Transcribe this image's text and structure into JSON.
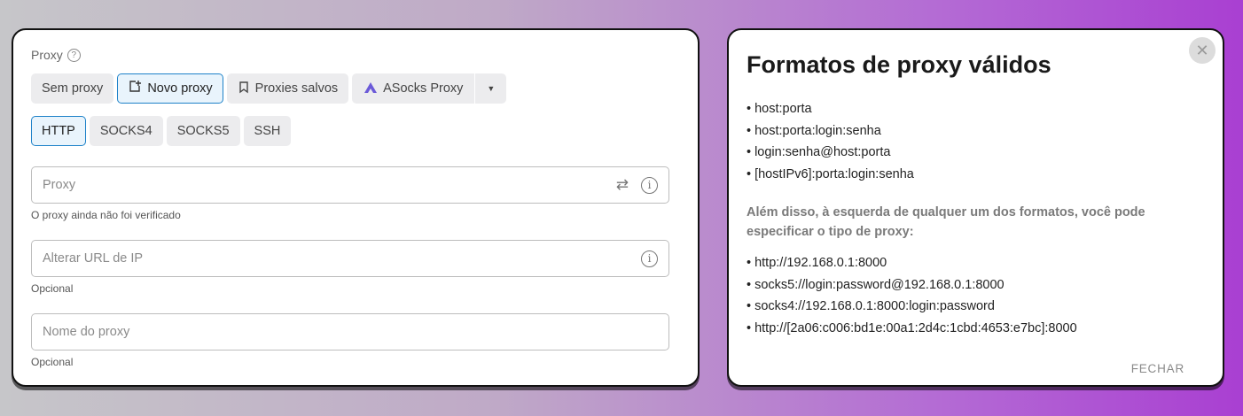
{
  "proxy_form": {
    "label": "Proxy",
    "help_glyph": "?",
    "source_tabs": [
      {
        "label": "Sem proxy",
        "icon": "",
        "active": false
      },
      {
        "label": "Novo proxy",
        "icon": "new-proxy-icon",
        "active": true
      },
      {
        "label": "Proxies salvos",
        "icon": "bookmark-icon",
        "active": false
      },
      {
        "label": "ASocks Proxy",
        "icon": "asocks-logo-icon",
        "active": false
      }
    ],
    "type_tabs": [
      "HTTP",
      "SOCKS4",
      "SOCKS5",
      "SSH"
    ],
    "active_type": "HTTP",
    "proxy_field": {
      "placeholder": "Proxy",
      "helper": "O proxy ainda não foi verificado"
    },
    "ip_change_field": {
      "placeholder": "Alterar URL de IP",
      "helper": "Opcional"
    },
    "name_field": {
      "placeholder": "Nome do proxy",
      "helper": "Opcional"
    }
  },
  "formats_modal": {
    "title": "Formatos de proxy válidos",
    "formats": [
      "host:porta",
      "host:porta:login:senha",
      "login:senha@host:porta",
      "[hostIPv6]:porta:login:senha"
    ],
    "note": "Além disso, à esquerda de qualquer um dos formatos, você pode especificar o tipo de proxy:",
    "examples": [
      "http://192.168.0.1:8000",
      "socks5://login:password@192.168.0.1:8000",
      "socks4://192.168.0.1:8000:login:password",
      "http://[2a06:c006:bd1e:00a1:2d4c:1cbd:4653:e7bc]:8000"
    ],
    "close_label": "FECHAR"
  },
  "colors": {
    "accent": "#1e82c9",
    "active_bg": "#e9f4fc",
    "asocks": "#6b5ad8"
  }
}
